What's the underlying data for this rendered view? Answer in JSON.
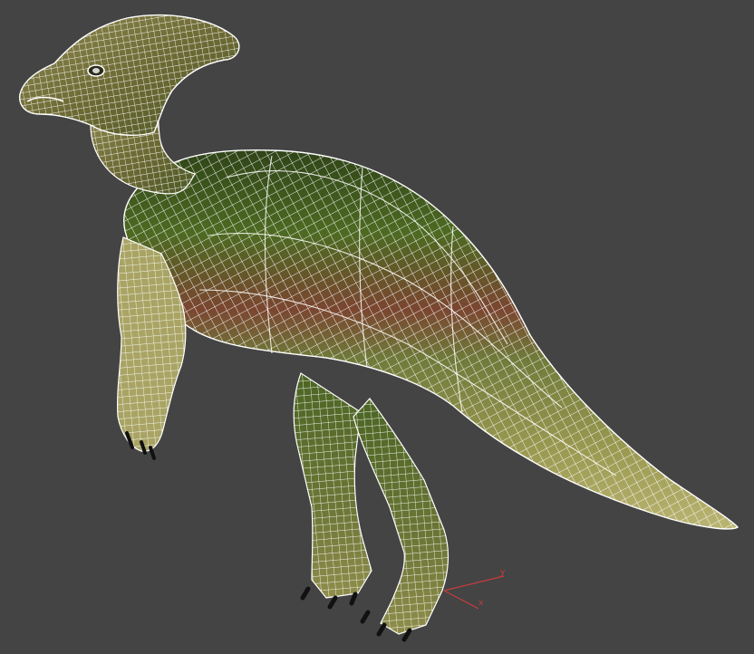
{
  "viewport": {
    "background_color": "#444444",
    "wire_color": "#ffffff",
    "body_colors": {
      "belly": "#9c9a52",
      "back": "#4d6a22",
      "stripe": "#7a4630",
      "dark": "#34451c",
      "claw": "#111111"
    },
    "gizmo": {
      "axis_color": "#c83c3c",
      "x_label": "x",
      "y_label": "y"
    }
  }
}
